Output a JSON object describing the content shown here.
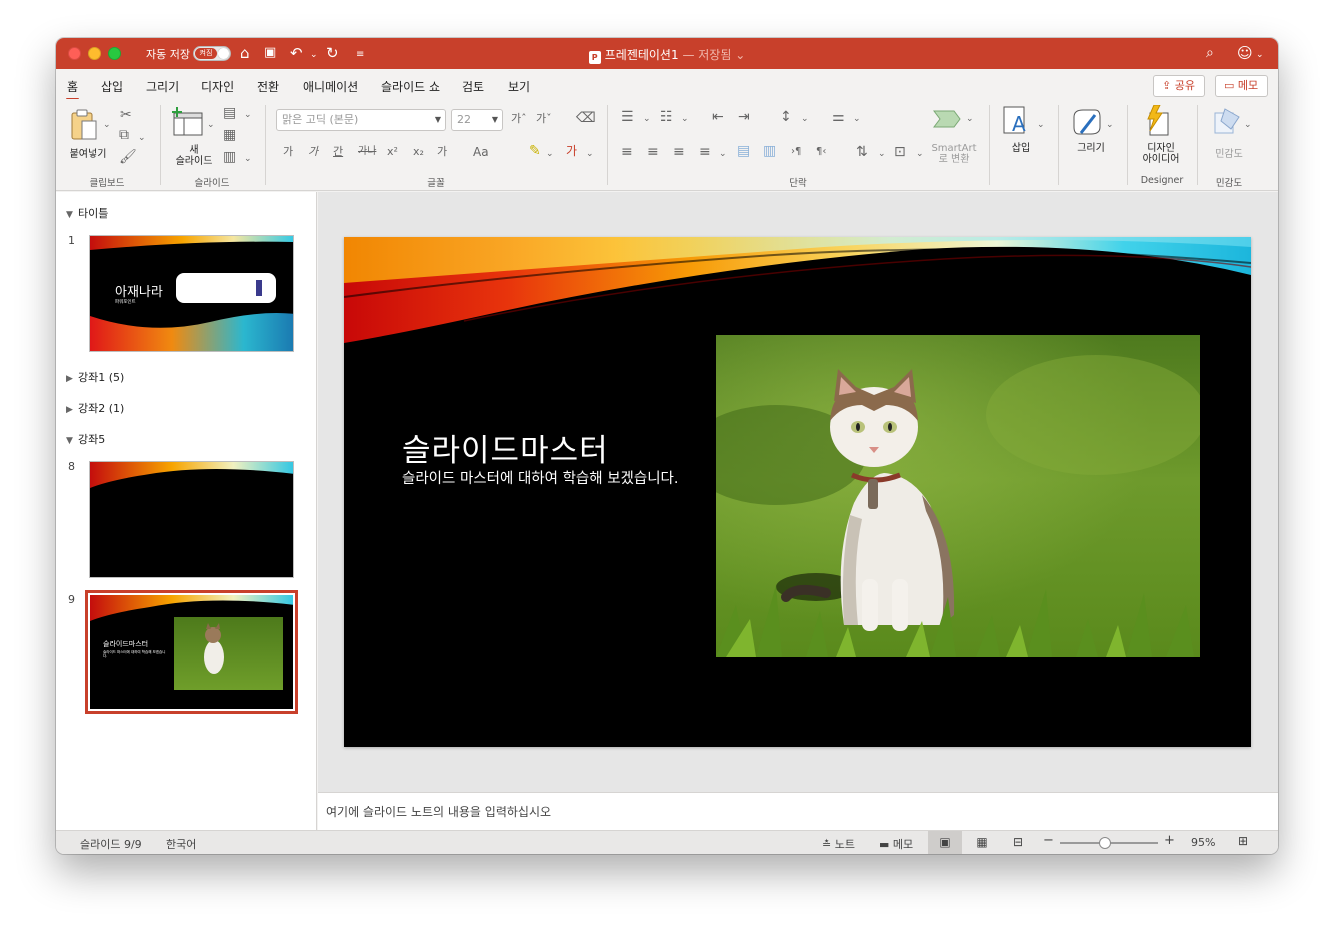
{
  "titlebar": {
    "autosave_label": "자동 저장",
    "autosave_state": "켜짐",
    "doc_name": "프레젠테이션1",
    "saved_status": "— 저장됨 ⌄"
  },
  "menu": {
    "tabs": [
      "홈",
      "삽입",
      "그리기",
      "디자인",
      "전환",
      "애니메이션",
      "슬라이드 쇼",
      "검토",
      "보기"
    ],
    "active_tab": "홈",
    "share_label": "공유",
    "memo_label": "메모"
  },
  "ribbon": {
    "paste_label": "붙여넣기",
    "new_slide_label_1": "새",
    "new_slide_label_2": "슬라이드",
    "font_name": "맑은 고딕 (본문)",
    "font_size": "22",
    "smartart_label_1": "SmartArt",
    "smartart_label_2": "로 변환",
    "insert_label": "삽입",
    "draw_label": "그리기",
    "design_ideas_label_1": "디자인",
    "design_ideas_label_2": "아이디어",
    "sensitivity_label": "민감도",
    "groups": {
      "clipboard": "클립보드",
      "slides": "슬라이드",
      "font": "글꼴",
      "paragraph": "단락",
      "designer": "Designer",
      "sensitivity": "민감도"
    },
    "font_buttons": [
      "가",
      "가",
      "간",
      "가나",
      "x²",
      "x₂",
      "가",
      "Aa"
    ]
  },
  "slide_panel": {
    "sections": [
      {
        "name": "타이틀",
        "expanded": true
      },
      {
        "name": "강좌1 (5)",
        "expanded": false
      },
      {
        "name": "강좌2 (1)",
        "expanded": false
      },
      {
        "name": "강좌5",
        "expanded": true
      }
    ],
    "thumbnails": [
      {
        "number": "1",
        "title": "아재나라",
        "subtitle": "파워포인트"
      },
      {
        "number": "8"
      },
      {
        "number": "9",
        "title": "슬라이드마스터",
        "subtitle": "슬라이드 마스터에 대하여 학습해 보겠습니다.",
        "selected": true
      }
    ]
  },
  "slide": {
    "title": "슬라이드마스터",
    "subtitle": "슬라이드 마스터에 대하여 학습해 보겠습니다."
  },
  "notes": {
    "placeholder": "여기에 슬라이드 노트의 내용을 입력하십시오"
  },
  "status": {
    "slide_counter": "슬라이드 9/9",
    "language": "한국어",
    "notes_label": "노트",
    "comments_label": "메모",
    "zoom": "95%",
    "zoom_fraction": 0.46
  },
  "colors": {
    "accent": "#c8402b",
    "titlebar": "#c8402b",
    "ribbon_bg": "#f3f2f1"
  }
}
